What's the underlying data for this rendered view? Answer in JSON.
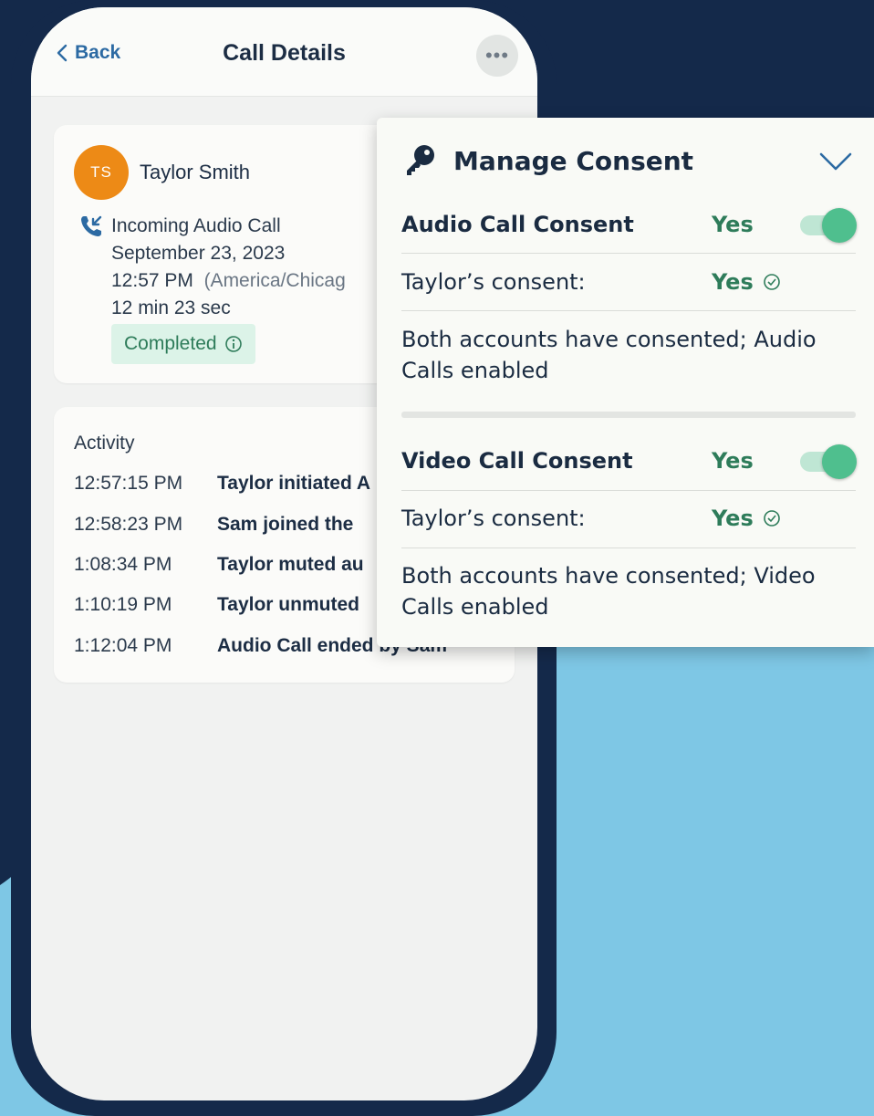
{
  "colors": {
    "page_bg": "#14294a",
    "accent_blue": "#7ec7e5",
    "accent_green": "#2e7c5a",
    "avatar_orange": "#ed8a16"
  },
  "header": {
    "back_label": "Back",
    "title": "Call Details",
    "more_icon": "ellipsis-icon"
  },
  "call": {
    "avatar_initials": "TS",
    "contact_name": "Taylor Smith",
    "call_type": "Incoming Audio Call",
    "date": "September 23, 2023",
    "time": "12:57 PM",
    "timezone": "(America/Chicag",
    "duration": "12 min 23 sec",
    "status": "Completed"
  },
  "activity": {
    "title": "Activity",
    "rows": [
      {
        "time": "12:57:15 PM",
        "text": "Taylor initiated A"
      },
      {
        "time": "12:58:23 PM",
        "text": "Sam joined the"
      },
      {
        "time": "1:08:34 PM",
        "text": "Taylor muted au"
      },
      {
        "time": "1:10:19 PM",
        "text": "Taylor unmuted"
      },
      {
        "time": "1:12:04 PM",
        "text": "Audio Call ended by Sam"
      }
    ]
  },
  "consent": {
    "title": "Manage Consent",
    "audio": {
      "title": "Audio Call Consent",
      "value": "Yes",
      "enabled": true,
      "party_label": "Taylor’s consent:",
      "party_value": "Yes",
      "description": "Both accounts have consented; Audio Calls enabled"
    },
    "video": {
      "title": "Video Call Consent",
      "value": "Yes",
      "enabled": true,
      "party_label": "Taylor’s consent:",
      "party_value": "Yes",
      "description": "Both accounts have consented; Video Calls enabled"
    }
  }
}
